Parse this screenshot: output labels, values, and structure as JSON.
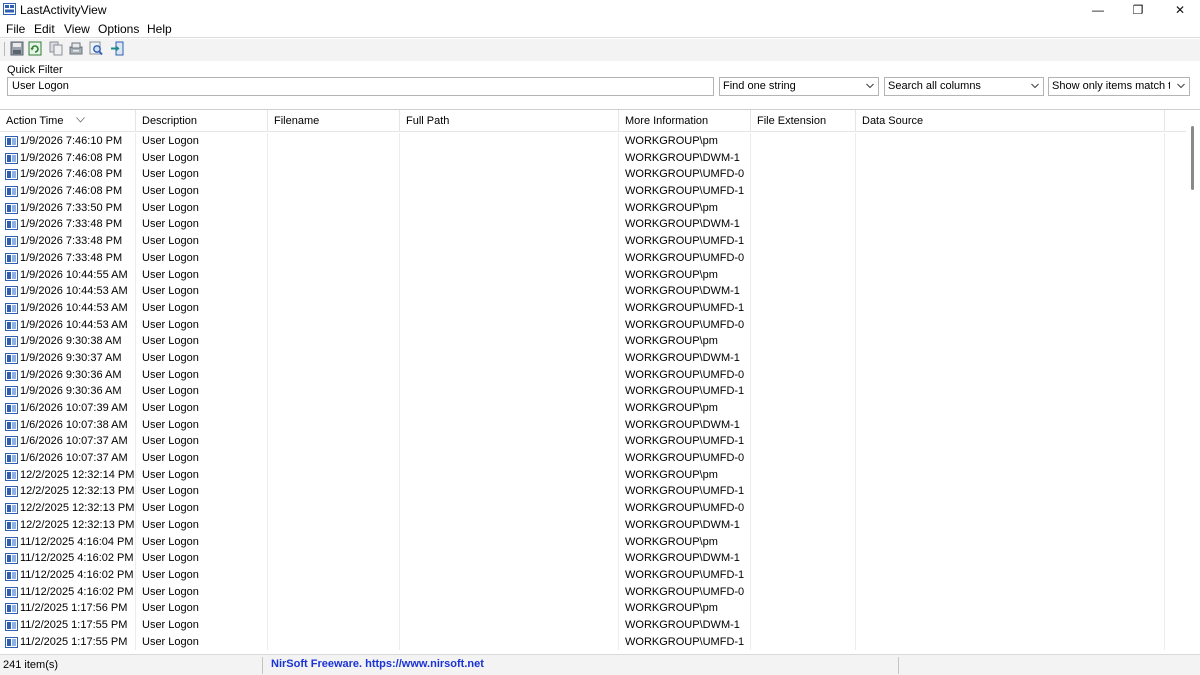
{
  "window": {
    "title": "LastActivityView",
    "minimize": "—",
    "maximize": "❐",
    "close": "✕"
  },
  "menu": [
    "File",
    "Edit",
    "View",
    "Options",
    "Help"
  ],
  "toolbar": [
    "save-icon",
    "refresh-icon",
    "copy-icon",
    "properties-icon",
    "find-icon",
    "exit-icon"
  ],
  "quick_filter": {
    "label": "Quick Filter",
    "value": "User Logon",
    "mode": "Find one string",
    "scope": "Search all columns",
    "match": "Show only items match the filter"
  },
  "columns": [
    "Action Time",
    "Description",
    "Filename",
    "Full Path",
    "More Information",
    "File Extension",
    "Data Source"
  ],
  "rows": [
    [
      "1/9/2026 7:46:10 PM",
      "User Logon",
      "",
      "",
      "WORKGROUP\\pm",
      "",
      ""
    ],
    [
      "1/9/2026 7:46:08 PM",
      "User Logon",
      "",
      "",
      "WORKGROUP\\DWM-1",
      "",
      ""
    ],
    [
      "1/9/2026 7:46:08 PM",
      "User Logon",
      "",
      "",
      "WORKGROUP\\UMFD-0",
      "",
      ""
    ],
    [
      "1/9/2026 7:46:08 PM",
      "User Logon",
      "",
      "",
      "WORKGROUP\\UMFD-1",
      "",
      ""
    ],
    [
      "1/9/2026 7:33:50 PM",
      "User Logon",
      "",
      "",
      "WORKGROUP\\pm",
      "",
      ""
    ],
    [
      "1/9/2026 7:33:48 PM",
      "User Logon",
      "",
      "",
      "WORKGROUP\\DWM-1",
      "",
      ""
    ],
    [
      "1/9/2026 7:33:48 PM",
      "User Logon",
      "",
      "",
      "WORKGROUP\\UMFD-1",
      "",
      ""
    ],
    [
      "1/9/2026 7:33:48 PM",
      "User Logon",
      "",
      "",
      "WORKGROUP\\UMFD-0",
      "",
      ""
    ],
    [
      "1/9/2026 10:44:55 AM",
      "User Logon",
      "",
      "",
      "WORKGROUP\\pm",
      "",
      ""
    ],
    [
      "1/9/2026 10:44:53 AM",
      "User Logon",
      "",
      "",
      "WORKGROUP\\DWM-1",
      "",
      ""
    ],
    [
      "1/9/2026 10:44:53 AM",
      "User Logon",
      "",
      "",
      "WORKGROUP\\UMFD-1",
      "",
      ""
    ],
    [
      "1/9/2026 10:44:53 AM",
      "User Logon",
      "",
      "",
      "WORKGROUP\\UMFD-0",
      "",
      ""
    ],
    [
      "1/9/2026 9:30:38 AM",
      "User Logon",
      "",
      "",
      "WORKGROUP\\pm",
      "",
      ""
    ],
    [
      "1/9/2026 9:30:37 AM",
      "User Logon",
      "",
      "",
      "WORKGROUP\\DWM-1",
      "",
      ""
    ],
    [
      "1/9/2026 9:30:36 AM",
      "User Logon",
      "",
      "",
      "WORKGROUP\\UMFD-0",
      "",
      ""
    ],
    [
      "1/9/2026 9:30:36 AM",
      "User Logon",
      "",
      "",
      "WORKGROUP\\UMFD-1",
      "",
      ""
    ],
    [
      "1/6/2026 10:07:39 AM",
      "User Logon",
      "",
      "",
      "WORKGROUP\\pm",
      "",
      ""
    ],
    [
      "1/6/2026 10:07:38 AM",
      "User Logon",
      "",
      "",
      "WORKGROUP\\DWM-1",
      "",
      ""
    ],
    [
      "1/6/2026 10:07:37 AM",
      "User Logon",
      "",
      "",
      "WORKGROUP\\UMFD-1",
      "",
      ""
    ],
    [
      "1/6/2026 10:07:37 AM",
      "User Logon",
      "",
      "",
      "WORKGROUP\\UMFD-0",
      "",
      ""
    ],
    [
      "12/2/2025 12:32:14 PM",
      "User Logon",
      "",
      "",
      "WORKGROUP\\pm",
      "",
      ""
    ],
    [
      "12/2/2025 12:32:13 PM",
      "User Logon",
      "",
      "",
      "WORKGROUP\\UMFD-1",
      "",
      ""
    ],
    [
      "12/2/2025 12:32:13 PM",
      "User Logon",
      "",
      "",
      "WORKGROUP\\UMFD-0",
      "",
      ""
    ],
    [
      "12/2/2025 12:32:13 PM",
      "User Logon",
      "",
      "",
      "WORKGROUP\\DWM-1",
      "",
      ""
    ],
    [
      "11/12/2025 4:16:04 PM",
      "User Logon",
      "",
      "",
      "WORKGROUP\\pm",
      "",
      ""
    ],
    [
      "11/12/2025 4:16:02 PM",
      "User Logon",
      "",
      "",
      "WORKGROUP\\DWM-1",
      "",
      ""
    ],
    [
      "11/12/2025 4:16:02 PM",
      "User Logon",
      "",
      "",
      "WORKGROUP\\UMFD-1",
      "",
      ""
    ],
    [
      "11/12/2025 4:16:02 PM",
      "User Logon",
      "",
      "",
      "WORKGROUP\\UMFD-0",
      "",
      ""
    ],
    [
      "11/2/2025 1:17:56 PM",
      "User Logon",
      "",
      "",
      "WORKGROUP\\pm",
      "",
      ""
    ],
    [
      "11/2/2025 1:17:55 PM",
      "User Logon",
      "",
      "",
      "WORKGROUP\\DWM-1",
      "",
      ""
    ],
    [
      "11/2/2025 1:17:55 PM",
      "User Logon",
      "",
      "",
      "WORKGROUP\\UMFD-1",
      "",
      ""
    ]
  ],
  "status": {
    "count": "241 item(s)",
    "credit": "NirSoft Freeware. https://www.nirsoft.net"
  },
  "colors": {
    "accent": "#1a33d6",
    "icon_blue": "#2f5fb3",
    "toolbar_bg": "#f3f3f3"
  }
}
